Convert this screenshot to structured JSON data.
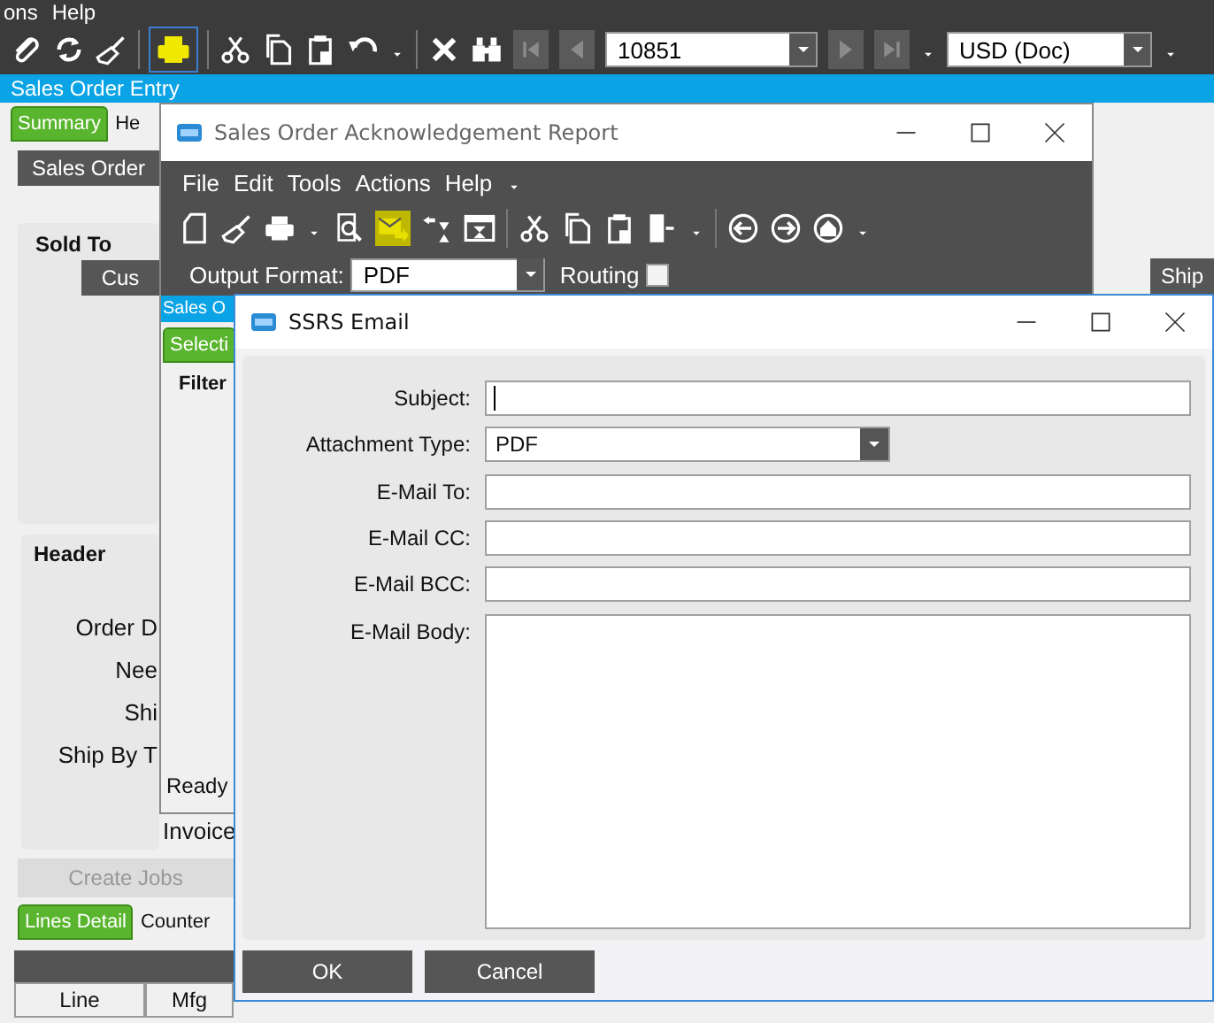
{
  "app_menu": [
    "ons",
    "Help"
  ],
  "main_toolbar": {
    "record": "10851",
    "currency": "USD (Doc)"
  },
  "main_window": {
    "title": "Sales Order Entry",
    "tabs": [
      {
        "label": "Summary",
        "selected": true
      },
      {
        "label": "He",
        "selected": false
      }
    ],
    "sales_order_button": "Sales Order",
    "sold_to": {
      "label": "Sold To",
      "customer_button": "Cus",
      "ship_button": "Ship"
    },
    "header": {
      "label": "Header",
      "fields": [
        "Order D",
        "Nee",
        "Shi",
        "Ship By T"
      ],
      "invoice_label": "Invoice"
    },
    "create_jobs": {
      "label": "Create Jobs",
      "disabled": true
    },
    "lines_tabs": [
      {
        "label": "Lines Detail",
        "selected": true
      },
      {
        "label": "Counter",
        "selected": false
      }
    ],
    "table_columns": [
      "Line",
      "Mfg"
    ]
  },
  "report_window": {
    "title": "Sales Order Acknowledgement Report",
    "menu": [
      "File",
      "Edit",
      "Tools",
      "Actions",
      "Help"
    ],
    "output_format_label": "Output Format:",
    "output_format": "PDF",
    "routing_label": "Routing",
    "routing_checked": false,
    "inner_title": "Sales O",
    "tabs": [
      {
        "label": "Selecti",
        "selected": true
      }
    ],
    "filter_label": "Filter",
    "status": "Ready"
  },
  "email_dialog": {
    "title": "SSRS Email",
    "fields": [
      {
        "label": "Subject:",
        "kind": "text",
        "focused": true
      },
      {
        "label": "Attachment Type:",
        "kind": "select",
        "value": "PDF",
        "focused": false
      },
      {
        "label": "E-Mail To:",
        "kind": "text",
        "focused": false
      },
      {
        "label": "E-Mail CC:",
        "kind": "text",
        "focused": false
      },
      {
        "label": "E-Mail BCC:",
        "kind": "text",
        "focused": false
      },
      {
        "label": "E-Mail Body:",
        "kind": "textarea",
        "focused": false
      }
    ],
    "buttons": [
      "OK",
      "Cancel"
    ]
  }
}
